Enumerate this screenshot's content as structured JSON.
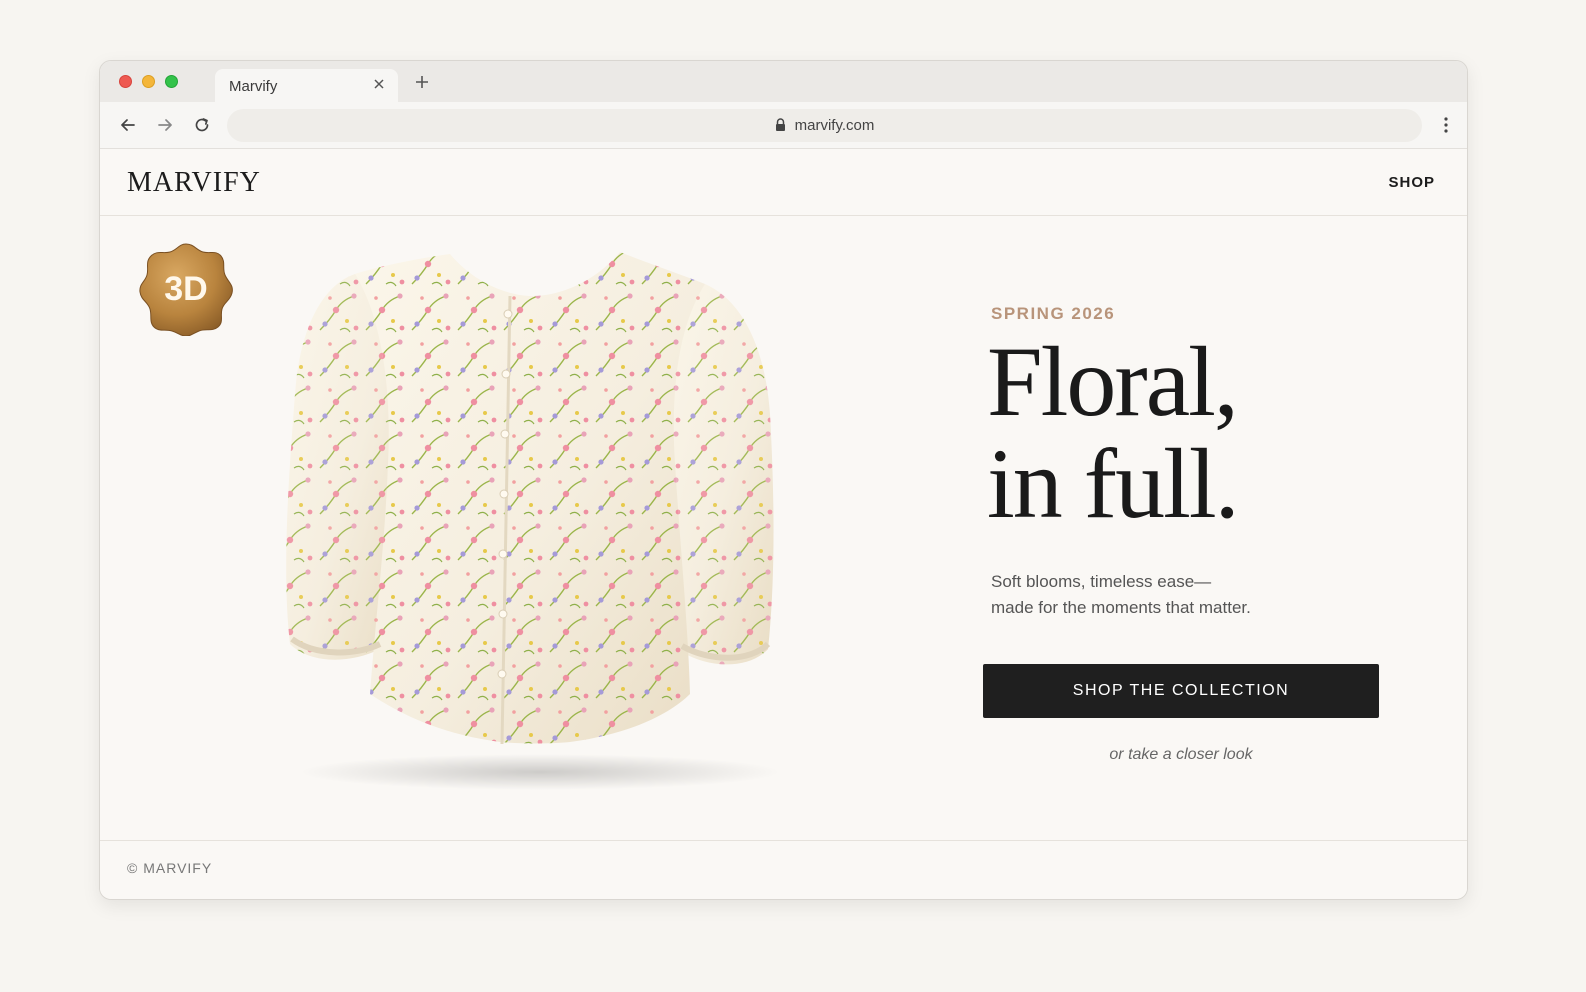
{
  "browser": {
    "tab_title": "Marvify",
    "url": "marvify.com"
  },
  "site": {
    "logo": "MARVIFY",
    "nav_shop": "SHOP"
  },
  "hero": {
    "badge_text": "3D",
    "eyebrow": "SPRING 2026",
    "headline_line1": "Floral,",
    "headline_line2": "in full.",
    "subcopy_line1": "Soft blooms, timeless ease—",
    "subcopy_line2": "made for the moments that matter.",
    "cta_label": "SHOP THE COLLECTION",
    "secondary_link": "or take a closer look",
    "product_image": "floral-puff-sleeve-blouse"
  },
  "footer": {
    "copyright": "© MARVIFY"
  },
  "colors": {
    "page_bg": "#faf8f5",
    "accent": "#b8947a",
    "cta_bg": "#1f1f1f",
    "badge_gold": "#b9843e"
  }
}
